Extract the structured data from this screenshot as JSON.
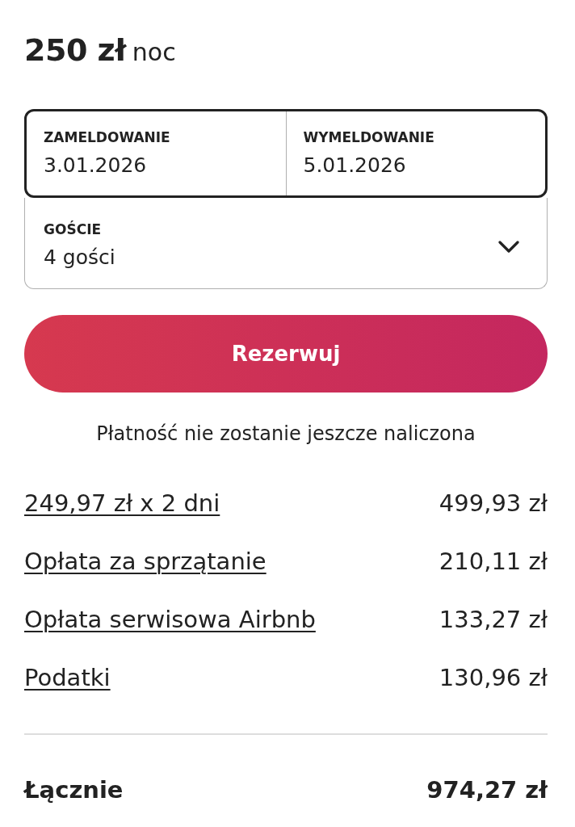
{
  "price": {
    "amount": "250 zł",
    "unit": "noc"
  },
  "booking": {
    "dates": {
      "selected": true,
      "check_in": {
        "label": "ZAMELDOWANIE",
        "value": "3.01.2026"
      },
      "check_out": {
        "label": "WYMELDOWANIE",
        "value": "5.01.2026"
      }
    },
    "guests": {
      "label": "GOŚCIE",
      "value": "4 gości",
      "expanded": false
    }
  },
  "reserve_button": {
    "label": "Rezerwuj"
  },
  "payment_note": "Płatność nie zostanie jeszcze naliczona",
  "fees": [
    {
      "label": "249,97 zł x 2 dni",
      "amount": "499,93 zł"
    },
    {
      "label": "Opłata za sprzątanie",
      "amount": "210,11 zł"
    },
    {
      "label": "Opłata serwisowa Airbnb",
      "amount": "133,27 zł"
    },
    {
      "label": "Podatki",
      "amount": "130,96 zł"
    }
  ],
  "total": {
    "label": "Łącznie",
    "amount": "974,27 zł"
  }
}
